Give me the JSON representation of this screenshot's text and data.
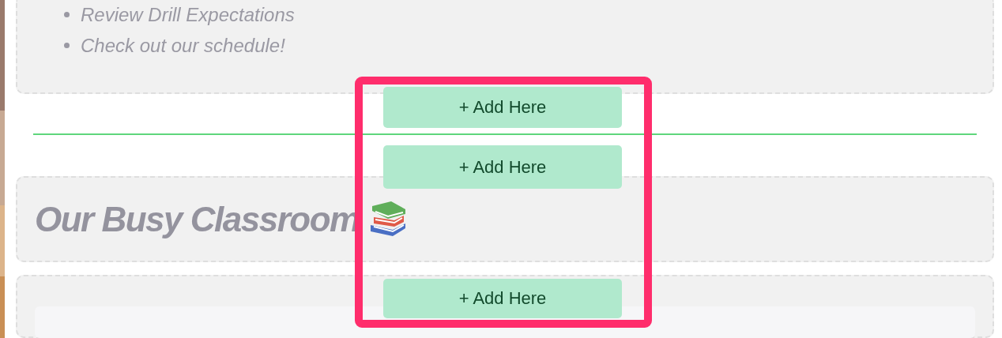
{
  "list_items": [
    "Review Drill Expectations",
    "Check out our schedule!"
  ],
  "heading": {
    "title": "Our Busy Classroom"
  },
  "add_buttons": [
    "+ Add Here",
    "+ Add Here",
    "+ Add Here"
  ]
}
